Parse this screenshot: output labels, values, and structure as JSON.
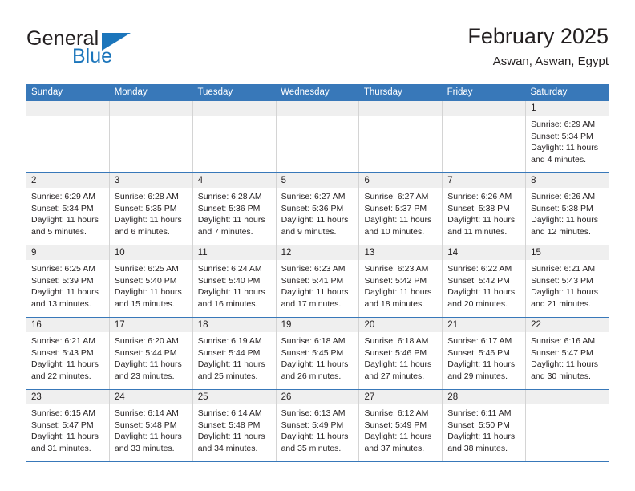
{
  "brand": {
    "name_part1": "General",
    "name_part2": "Blue",
    "logo_icon": "triangle-icon"
  },
  "header": {
    "title": "February 2025",
    "subtitle": "Aswan, Aswan, Egypt"
  },
  "calendar": {
    "weekdays": [
      "Sunday",
      "Monday",
      "Tuesday",
      "Wednesday",
      "Thursday",
      "Friday",
      "Saturday"
    ],
    "colors": {
      "header_blue": "#3878b9",
      "band_gray": "#efefef",
      "brand_blue": "#1b75bb",
      "text": "#231f20"
    },
    "weeks": [
      [
        {
          "empty": true
        },
        {
          "empty": true
        },
        {
          "empty": true
        },
        {
          "empty": true
        },
        {
          "empty": true
        },
        {
          "empty": true
        },
        {
          "day": "1",
          "sunrise": "Sunrise: 6:29 AM",
          "sunset": "Sunset: 5:34 PM",
          "daylight1": "Daylight: 11 hours",
          "daylight2": "and 4 minutes."
        }
      ],
      [
        {
          "day": "2",
          "sunrise": "Sunrise: 6:29 AM",
          "sunset": "Sunset: 5:34 PM",
          "daylight1": "Daylight: 11 hours",
          "daylight2": "and 5 minutes."
        },
        {
          "day": "3",
          "sunrise": "Sunrise: 6:28 AM",
          "sunset": "Sunset: 5:35 PM",
          "daylight1": "Daylight: 11 hours",
          "daylight2": "and 6 minutes."
        },
        {
          "day": "4",
          "sunrise": "Sunrise: 6:28 AM",
          "sunset": "Sunset: 5:36 PM",
          "daylight1": "Daylight: 11 hours",
          "daylight2": "and 7 minutes."
        },
        {
          "day": "5",
          "sunrise": "Sunrise: 6:27 AM",
          "sunset": "Sunset: 5:36 PM",
          "daylight1": "Daylight: 11 hours",
          "daylight2": "and 9 minutes."
        },
        {
          "day": "6",
          "sunrise": "Sunrise: 6:27 AM",
          "sunset": "Sunset: 5:37 PM",
          "daylight1": "Daylight: 11 hours",
          "daylight2": "and 10 minutes."
        },
        {
          "day": "7",
          "sunrise": "Sunrise: 6:26 AM",
          "sunset": "Sunset: 5:38 PM",
          "daylight1": "Daylight: 11 hours",
          "daylight2": "and 11 minutes."
        },
        {
          "day": "8",
          "sunrise": "Sunrise: 6:26 AM",
          "sunset": "Sunset: 5:38 PM",
          "daylight1": "Daylight: 11 hours",
          "daylight2": "and 12 minutes."
        }
      ],
      [
        {
          "day": "9",
          "sunrise": "Sunrise: 6:25 AM",
          "sunset": "Sunset: 5:39 PM",
          "daylight1": "Daylight: 11 hours",
          "daylight2": "and 13 minutes."
        },
        {
          "day": "10",
          "sunrise": "Sunrise: 6:25 AM",
          "sunset": "Sunset: 5:40 PM",
          "daylight1": "Daylight: 11 hours",
          "daylight2": "and 15 minutes."
        },
        {
          "day": "11",
          "sunrise": "Sunrise: 6:24 AM",
          "sunset": "Sunset: 5:40 PM",
          "daylight1": "Daylight: 11 hours",
          "daylight2": "and 16 minutes."
        },
        {
          "day": "12",
          "sunrise": "Sunrise: 6:23 AM",
          "sunset": "Sunset: 5:41 PM",
          "daylight1": "Daylight: 11 hours",
          "daylight2": "and 17 minutes."
        },
        {
          "day": "13",
          "sunrise": "Sunrise: 6:23 AM",
          "sunset": "Sunset: 5:42 PM",
          "daylight1": "Daylight: 11 hours",
          "daylight2": "and 18 minutes."
        },
        {
          "day": "14",
          "sunrise": "Sunrise: 6:22 AM",
          "sunset": "Sunset: 5:42 PM",
          "daylight1": "Daylight: 11 hours",
          "daylight2": "and 20 minutes."
        },
        {
          "day": "15",
          "sunrise": "Sunrise: 6:21 AM",
          "sunset": "Sunset: 5:43 PM",
          "daylight1": "Daylight: 11 hours",
          "daylight2": "and 21 minutes."
        }
      ],
      [
        {
          "day": "16",
          "sunrise": "Sunrise: 6:21 AM",
          "sunset": "Sunset: 5:43 PM",
          "daylight1": "Daylight: 11 hours",
          "daylight2": "and 22 minutes."
        },
        {
          "day": "17",
          "sunrise": "Sunrise: 6:20 AM",
          "sunset": "Sunset: 5:44 PM",
          "daylight1": "Daylight: 11 hours",
          "daylight2": "and 23 minutes."
        },
        {
          "day": "18",
          "sunrise": "Sunrise: 6:19 AM",
          "sunset": "Sunset: 5:44 PM",
          "daylight1": "Daylight: 11 hours",
          "daylight2": "and 25 minutes."
        },
        {
          "day": "19",
          "sunrise": "Sunrise: 6:18 AM",
          "sunset": "Sunset: 5:45 PM",
          "daylight1": "Daylight: 11 hours",
          "daylight2": "and 26 minutes."
        },
        {
          "day": "20",
          "sunrise": "Sunrise: 6:18 AM",
          "sunset": "Sunset: 5:46 PM",
          "daylight1": "Daylight: 11 hours",
          "daylight2": "and 27 minutes."
        },
        {
          "day": "21",
          "sunrise": "Sunrise: 6:17 AM",
          "sunset": "Sunset: 5:46 PM",
          "daylight1": "Daylight: 11 hours",
          "daylight2": "and 29 minutes."
        },
        {
          "day": "22",
          "sunrise": "Sunrise: 6:16 AM",
          "sunset": "Sunset: 5:47 PM",
          "daylight1": "Daylight: 11 hours",
          "daylight2": "and 30 minutes."
        }
      ],
      [
        {
          "day": "23",
          "sunrise": "Sunrise: 6:15 AM",
          "sunset": "Sunset: 5:47 PM",
          "daylight1": "Daylight: 11 hours",
          "daylight2": "and 31 minutes."
        },
        {
          "day": "24",
          "sunrise": "Sunrise: 6:14 AM",
          "sunset": "Sunset: 5:48 PM",
          "daylight1": "Daylight: 11 hours",
          "daylight2": "and 33 minutes."
        },
        {
          "day": "25",
          "sunrise": "Sunrise: 6:14 AM",
          "sunset": "Sunset: 5:48 PM",
          "daylight1": "Daylight: 11 hours",
          "daylight2": "and 34 minutes."
        },
        {
          "day": "26",
          "sunrise": "Sunrise: 6:13 AM",
          "sunset": "Sunset: 5:49 PM",
          "daylight1": "Daylight: 11 hours",
          "daylight2": "and 35 minutes."
        },
        {
          "day": "27",
          "sunrise": "Sunrise: 6:12 AM",
          "sunset": "Sunset: 5:49 PM",
          "daylight1": "Daylight: 11 hours",
          "daylight2": "and 37 minutes."
        },
        {
          "day": "28",
          "sunrise": "Sunrise: 6:11 AM",
          "sunset": "Sunset: 5:50 PM",
          "daylight1": "Daylight: 11 hours",
          "daylight2": "and 38 minutes."
        },
        {
          "empty": true
        }
      ]
    ]
  }
}
